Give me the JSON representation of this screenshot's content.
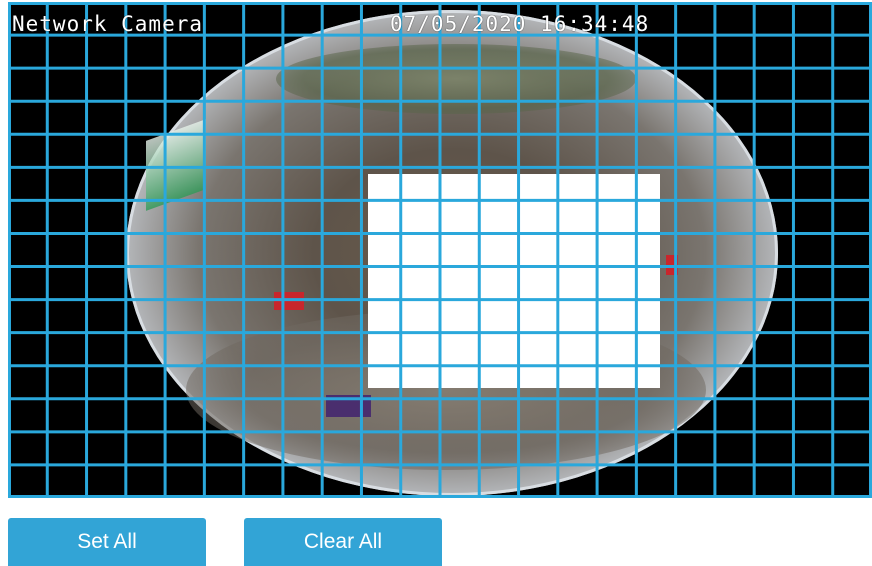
{
  "osd": {
    "title": "Network Camera",
    "timestamp": "07/05/2020  16:34:48"
  },
  "grid": {
    "columns": 22,
    "rows": 15,
    "line_color": "#2aa8dc"
  },
  "buttons": {
    "set_all": "Set All",
    "clear_all": "Clear All"
  },
  "colors": {
    "button_bg": "#32a4d6",
    "viewer_bg": "#000000"
  }
}
